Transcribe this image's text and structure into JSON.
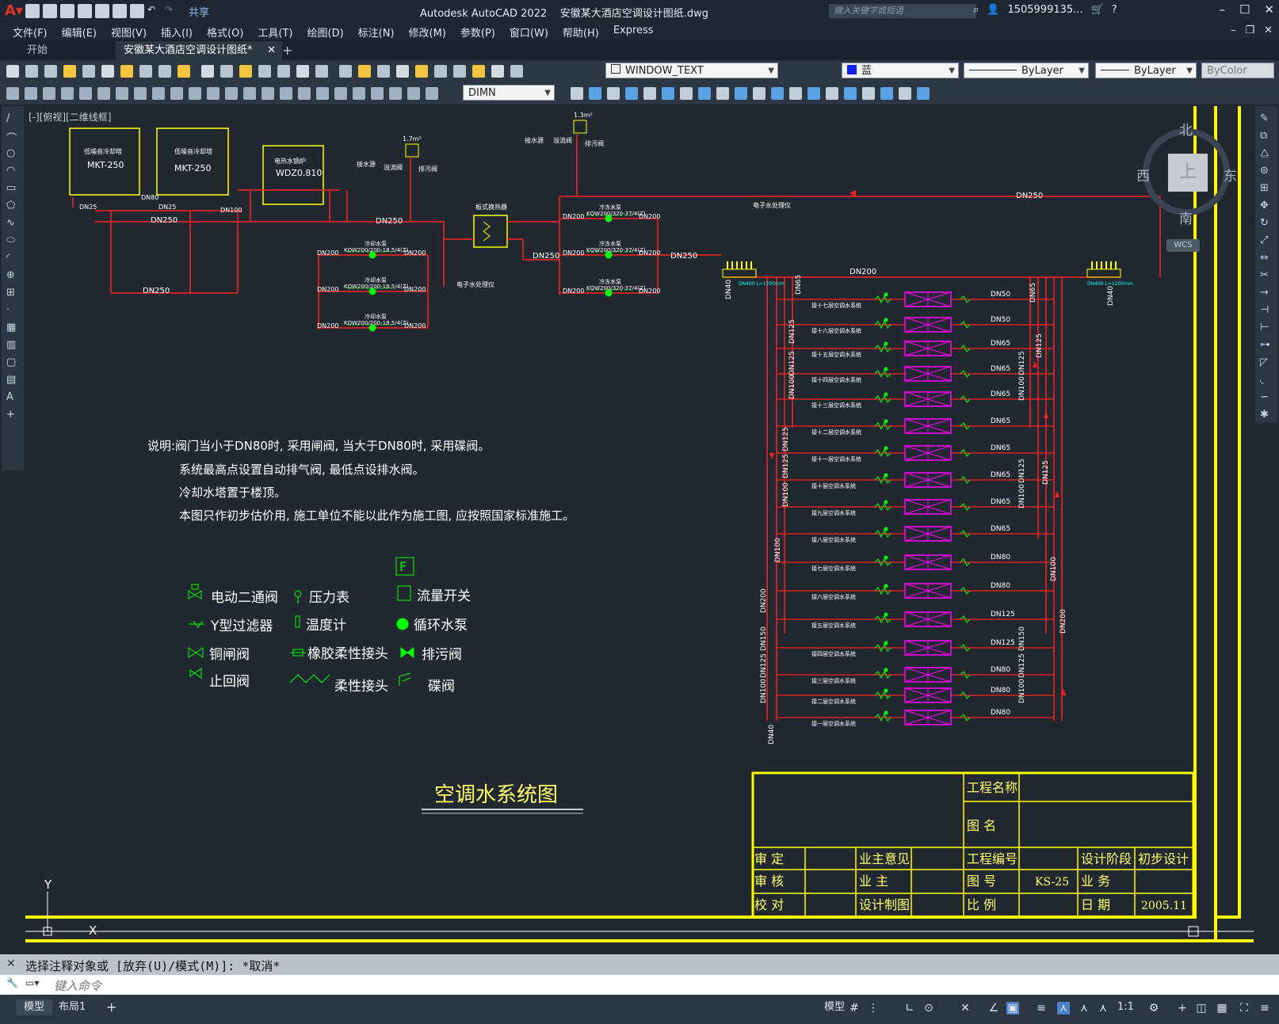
{
  "app": {
    "title": "Autodesk AutoCAD 2022",
    "file": "安徽某大酒店空调设计图纸.dwg",
    "search_placeholder": "键入关键字或短语",
    "user": "1505999135...",
    "share": "共享"
  },
  "menu": [
    "文件(F)",
    "编辑(E)",
    "视图(V)",
    "插入(I)",
    "格式(O)",
    "工具(T)",
    "绘图(D)",
    "标注(N)",
    "修改(M)",
    "参数(P)",
    "窗口(W)",
    "帮助(H)",
    "Express"
  ],
  "tabs": {
    "start": "开始",
    "doc": "安徽某大酒店空调设计图纸*",
    "add": "+"
  },
  "toolbar": {
    "layer": "WINDOW_TEXT",
    "color": "蓝",
    "linetype": "ByLayer",
    "lineweight": "ByLayer",
    "plotstyle": "ByColor",
    "dimstyle": "DIMN"
  },
  "view_label": "[-][俯视][二维线框]",
  "compass": {
    "n": "北",
    "s": "南",
    "e": "东",
    "w": "西",
    "top": "上",
    "wcs": "WCS"
  },
  "drawing": {
    "title": "空调水系统图",
    "notes": [
      "说明:阀门当小于DN80时, 采用闸阀, 当大于DN80时, 采用碟阀。",
      "系统最高点设置自动排气阀, 最低点设排水阀。",
      "冷却水塔置于楼顶。",
      "本图只作初步估价用, 施工单位不能以此作为施工图, 应按照国家标准施工。"
    ],
    "legend": [
      {
        "label": "电动二通阀"
      },
      {
        "label": "压力表"
      },
      {
        "label": "流量开关"
      },
      {
        "label": "Y型过滤器"
      },
      {
        "label": "温度计"
      },
      {
        "label": "循环水泵"
      },
      {
        "label": "铜闸阀"
      },
      {
        "label": "橡胶柔性接头"
      },
      {
        "label": "排污阀"
      },
      {
        "label": "止回阀"
      },
      {
        "label": "柔性接头"
      },
      {
        "label": "碟阀"
      }
    ],
    "legend_f": "F",
    "equipment": {
      "tower1_name": "低噪音冷却塔",
      "tower1": "MKT-250",
      "tower2_name": "低噪音冷却塔",
      "tower2": "MKT-250",
      "boiler_name": "电热水锅炉",
      "boiler": "WDZ0.810",
      "hx": "板式换热器",
      "pump_cool": "冷却水泵",
      "pump_chill": "冷冻水泵",
      "pump_cool_model": "KQW200/200-18.5/4(Z)",
      "pump_chill_model": "KQW200/320-37/4(Z)",
      "tank1": "1.7m³",
      "tank2": "1.3m³",
      "makeup": "接水源",
      "overflow": "溢流阀",
      "drain": "排污阀",
      "softener": "电子水处理仪"
    },
    "pipes": [
      "DN250",
      "DN200",
      "DN100",
      "DN125",
      "DN150",
      "DN80",
      "DN65",
      "DN50",
      "DN40",
      "DN25",
      "DN32"
    ],
    "floors": [
      "接十七层空调水系统",
      "接十六层空调水系统",
      "接十五层空调水系统",
      "接十四层空调水系统",
      "接十三层空调水系统",
      "接十二层空调水系统",
      "接十一层空调水系统",
      "接十层空调水系统",
      "接九层空调水系统",
      "接八层空调水系统",
      "接七层空调水系统",
      "接六层空调水系统",
      "接五层空调水系统",
      "接四层空调水系统",
      "接三层空调水系统",
      "接二层空调水系统",
      "接一层空调水系统"
    ],
    "branch_dn": [
      "DN50",
      "DN50",
      "DN65",
      "DN65",
      "DN65",
      "DN65",
      "DN65",
      "DN65",
      "DN65",
      "DN65",
      "DN80",
      "DN80",
      "DN125",
      "DN125",
      "DN80",
      "DN80",
      "DN80"
    ],
    "manifold": "DN400 L=1200mm",
    "titleblock": {
      "project_name": "工程名称",
      "drawing_name": "图    名",
      "approve": "审    定",
      "review": "审    核",
      "check": "校    对",
      "owner_opinion": "业主意见",
      "owner": "业    主",
      "design_draw": "设计制图",
      "project_no": "工程编号",
      "drawing_no": "图    号",
      "drawing_no_val": "KS-25",
      "scale": "比    例",
      "stage": "设计阶段",
      "stage_val": "初步设计",
      "business": "业    务",
      "date": "日    期",
      "date_val": "2005.11"
    },
    "ucs_x": "X",
    "ucs_y": "Y"
  },
  "command": {
    "history": "选择注释对象或 [放弃(U)/模式(M)]: *取消*",
    "placeholder": "键入命令"
  },
  "status": {
    "model": "模型",
    "layout": "布局1",
    "add": "+",
    "scale": "1:1"
  }
}
